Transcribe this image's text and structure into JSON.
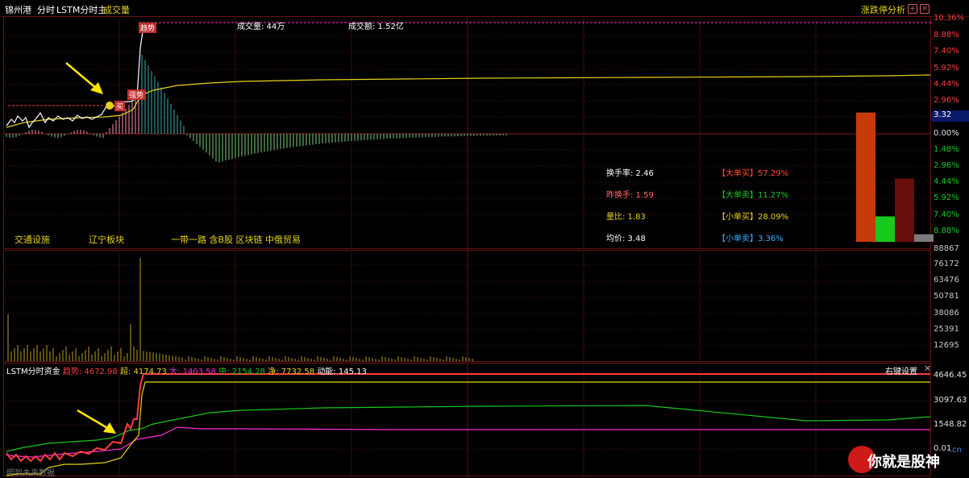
{
  "header": {
    "stock_name": "锦州港",
    "tab_time": "分时",
    "indicator_main": "LSTM分时主",
    "tab_volume": "成交量",
    "limit_analysis": "涨跌停分析",
    "add_icon": "plus-icon",
    "close_icon": "close-icon"
  },
  "price_panel": {
    "volume_text": "成交量: 44万",
    "turnover_text": "成交额: 1.52亿",
    "tags": {
      "trend": "趋势",
      "buy": "买",
      "strong": "强势"
    },
    "axis_labels_up": [
      "10.36%",
      "8.88%",
      "7.40%",
      "5.92%",
      "4.44%",
      "2.96%"
    ],
    "current_marker": "3.32",
    "axis_labels_mid": "0.00%",
    "axis_labels_down": [
      "1.48%",
      "2.96%",
      "4.44%",
      "5.92%",
      "7.40%",
      "8.88%"
    ]
  },
  "stats": {
    "turnover_rate": "换手率: 2.46",
    "prev_turnover": "昨换手: 1.59",
    "volume_ratio": "量比: 1.83",
    "avg_price": "均价: 3.48",
    "big_buy": "【大单买】57.29%",
    "big_sell": "【大单卖】11.27%",
    "small_buy": "【小单买】28.09%",
    "small_sell": "【小单卖】3.36%"
  },
  "stats_chart": {
    "bars": [
      {
        "name": "大单买",
        "value": 57.29,
        "color": "#c73a0a"
      },
      {
        "name": "大单卖",
        "value": 11.27,
        "color": "#17c91c"
      },
      {
        "name": "小单买",
        "value": 28.09,
        "color": "#6a0d0d"
      },
      {
        "name": "小单卖",
        "value": 3.36,
        "color": "#7a7a7a"
      }
    ]
  },
  "concepts": [
    "交通设施",
    "辽宁板块",
    "一带一路 含B股 区块链 中俄贸易"
  ],
  "volume_panel": {
    "axis_labels": [
      "88867",
      "76172",
      "63476",
      "50781",
      "38086",
      "25391",
      "12695"
    ]
  },
  "fund_panel": {
    "title": "LSTM分时资金",
    "trend": "趋势: 4672.98",
    "super": "超: 4174.73",
    "big": "大: 1403.58",
    "mid": "中: 2154.28",
    "net": "净: 7732.58",
    "momentum": "动能: 145.13",
    "right_setting": "右键设置",
    "axis_labels": [
      "4646.45",
      "3097.63",
      "1548.82",
      "0.01"
    ],
    "footer": "明到未来数据"
  },
  "watermark": {
    "text": "你就是股神",
    "suffix": ".cn"
  },
  "colors": {
    "up": "#ff3d3d",
    "down": "#17c91c",
    "yellow": "#e6d21a",
    "magenta": "#ff2bd6",
    "grid": "#5a0e0e"
  }
}
